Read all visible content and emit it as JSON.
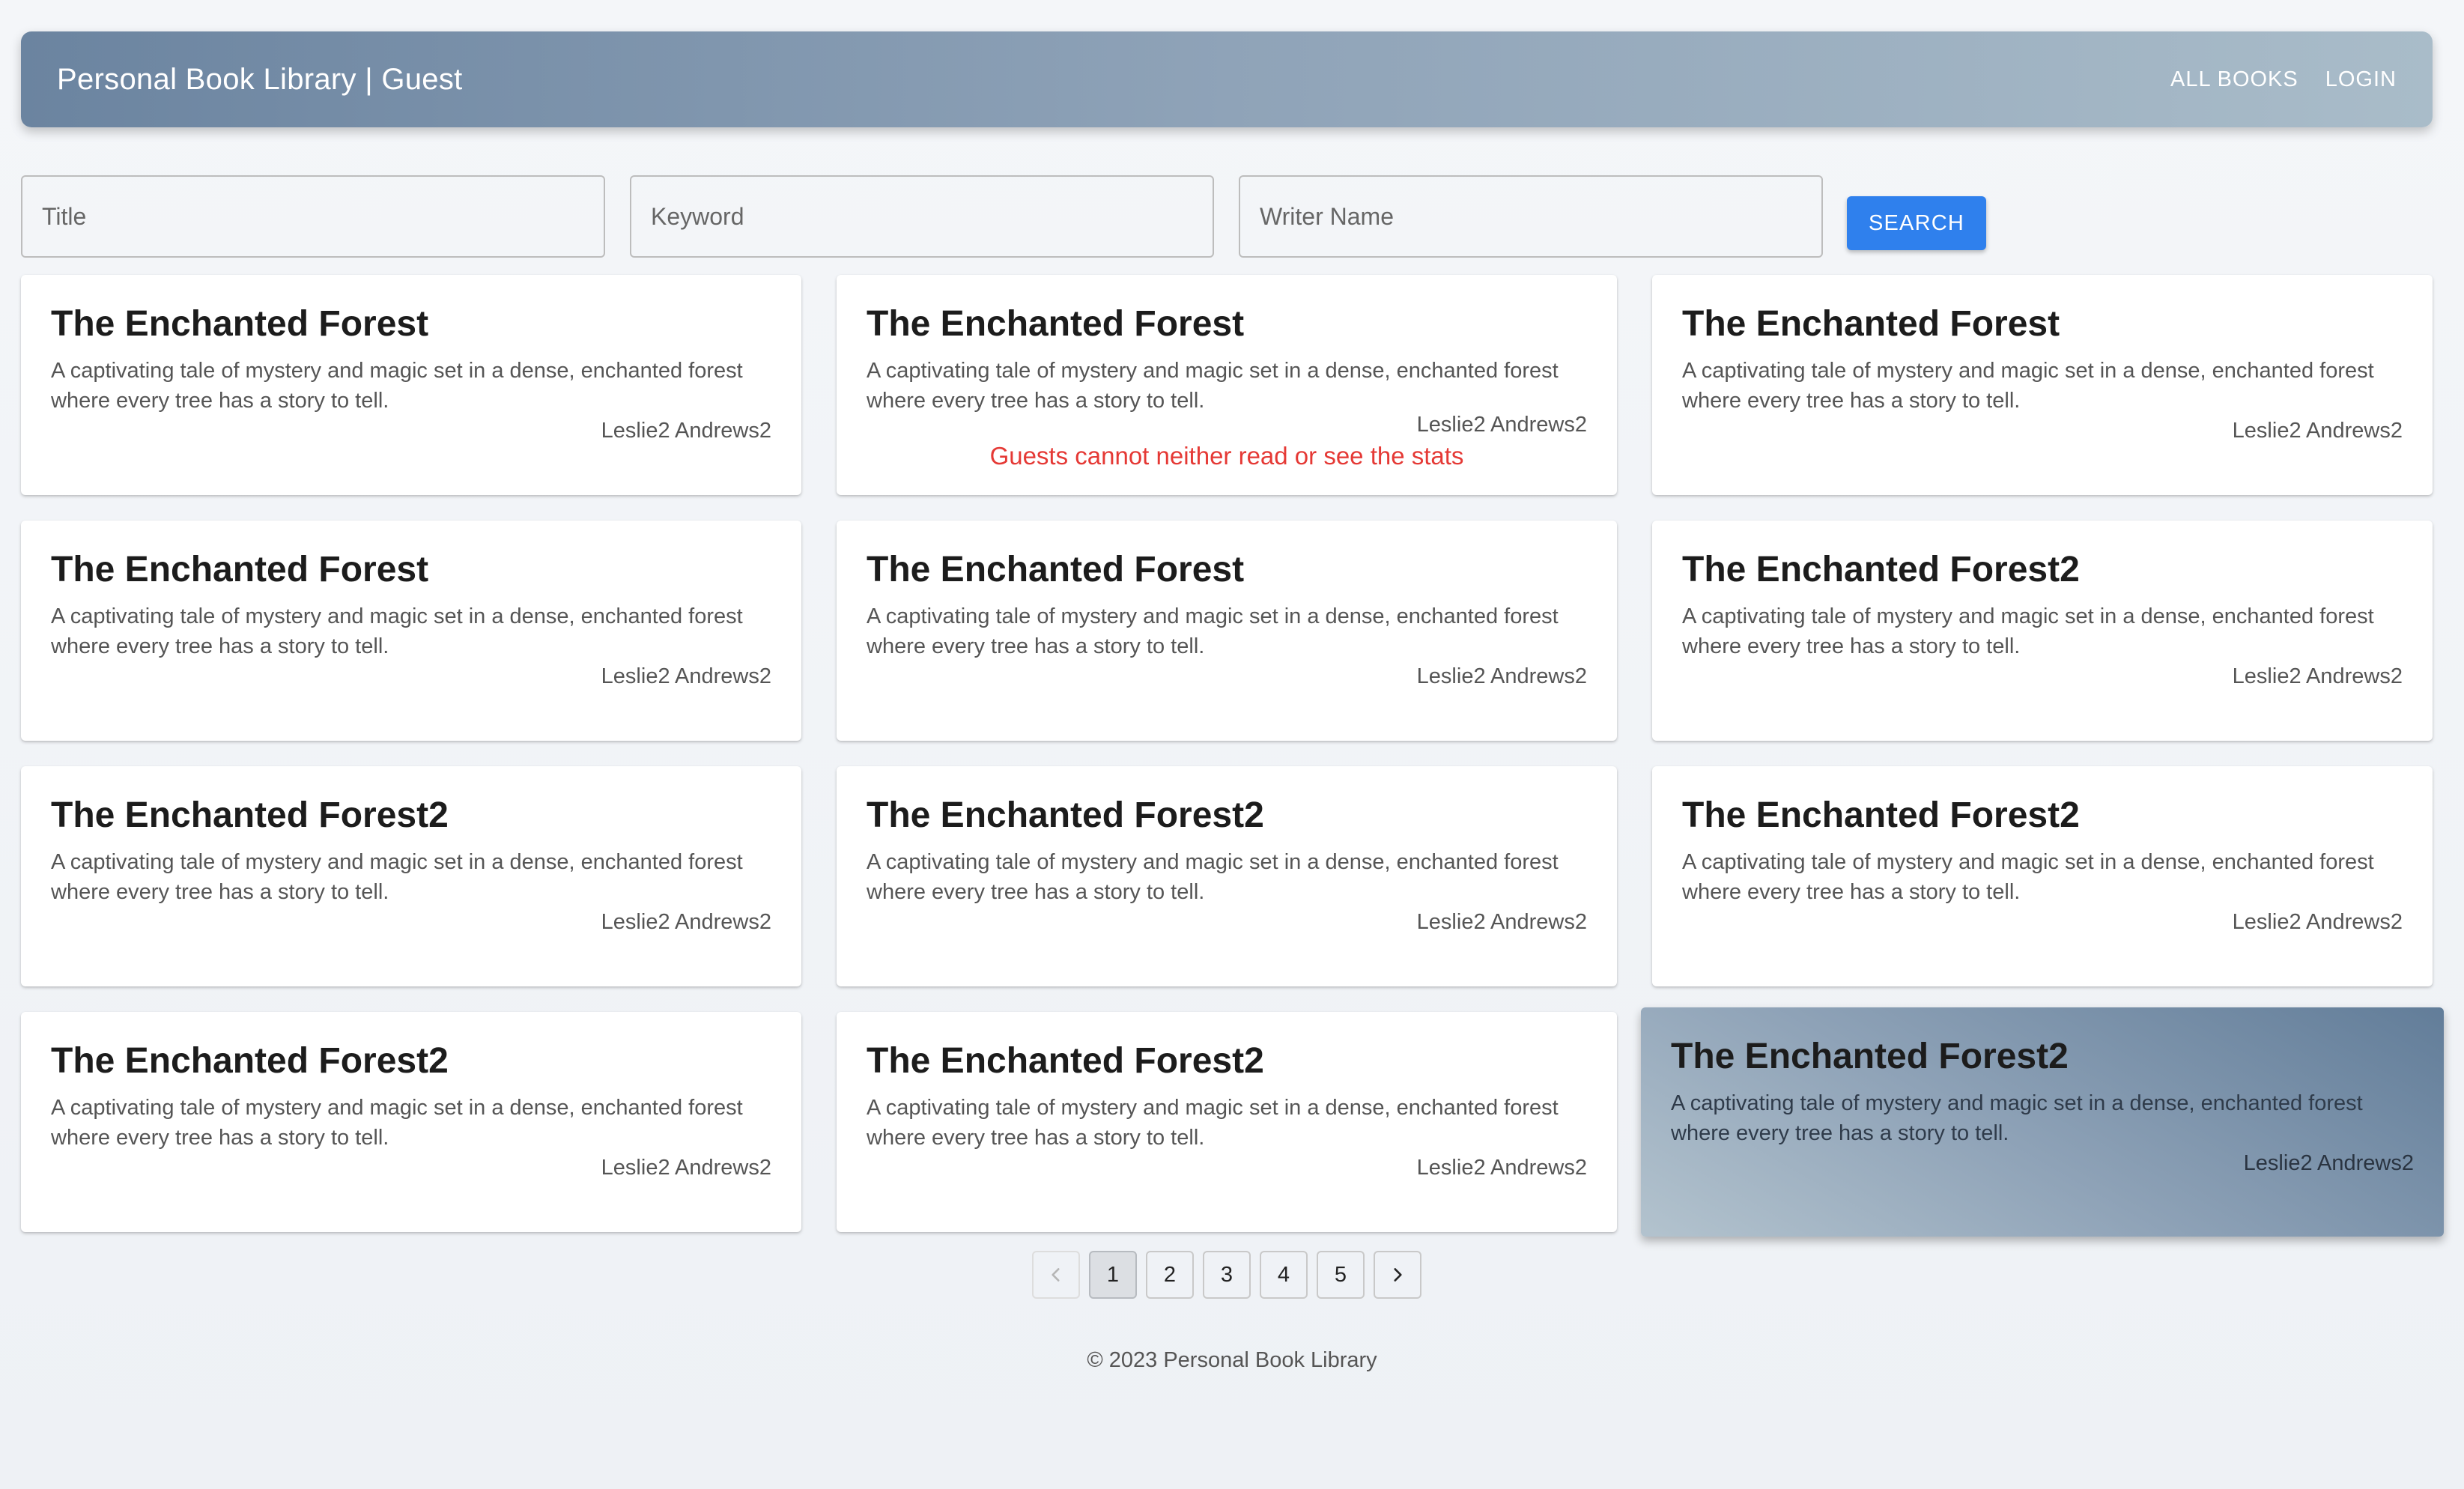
{
  "header": {
    "title": "Personal Book Library | Guest",
    "nav": [
      {
        "label": "ALL BOOKS"
      },
      {
        "label": "LOGIN"
      }
    ]
  },
  "search": {
    "title_placeholder": "Title",
    "keyword_placeholder": "Keyword",
    "writer_placeholder": "Writer Name",
    "button_label": "SEARCH"
  },
  "books": [
    {
      "title": "The Enchanted Forest",
      "description": "A captivating tale of mystery and magic set in a dense, enchanted forest where every tree has a story to tell.",
      "author": "Leslie2 Andrews2"
    },
    {
      "title": "The Enchanted Forest",
      "description": "A captivating tale of mystery and magic set in a dense, enchanted forest where every tree has a story to tell.",
      "author": "Leslie2 Andrews2",
      "notice": "Guests cannot neither read or see the stats"
    },
    {
      "title": "The Enchanted Forest",
      "description": "A captivating tale of mystery and magic set in a dense, enchanted forest where every tree has a story to tell.",
      "author": "Leslie2 Andrews2"
    },
    {
      "title": "The Enchanted Forest",
      "description": "A captivating tale of mystery and magic set in a dense, enchanted forest where every tree has a story to tell.",
      "author": "Leslie2 Andrews2"
    },
    {
      "title": "The Enchanted Forest",
      "description": "A captivating tale of mystery and magic set in a dense, enchanted forest where every tree has a story to tell.",
      "author": "Leslie2 Andrews2"
    },
    {
      "title": "The Enchanted Forest2",
      "description": "A captivating tale of mystery and magic set in a dense, enchanted forest where every tree has a story to tell.",
      "author": "Leslie2 Andrews2"
    },
    {
      "title": "The Enchanted Forest2",
      "description": "A captivating tale of mystery and magic set in a dense, enchanted forest where every tree has a story to tell.",
      "author": "Leslie2 Andrews2"
    },
    {
      "title": "The Enchanted Forest2",
      "description": "A captivating tale of mystery and magic set in a dense, enchanted forest where every tree has a story to tell.",
      "author": "Leslie2 Andrews2"
    },
    {
      "title": "The Enchanted Forest2",
      "description": "A captivating tale of mystery and magic set in a dense, enchanted forest where every tree has a story to tell.",
      "author": "Leslie2 Andrews2"
    },
    {
      "title": "The Enchanted Forest2",
      "description": "A captivating tale of mystery and magic set in a dense, enchanted forest where every tree has a story to tell.",
      "author": "Leslie2 Andrews2"
    },
    {
      "title": "The Enchanted Forest2",
      "description": "A captivating tale of mystery and magic set in a dense, enchanted forest where every tree has a story to tell.",
      "author": "Leslie2 Andrews2"
    },
    {
      "title": "The Enchanted Forest2",
      "description": "A captivating tale of mystery and magic set in a dense, enchanted forest where every tree has a story to tell.",
      "author": "Leslie2 Andrews2"
    }
  ],
  "pagination": {
    "pages": [
      "1",
      "2",
      "3",
      "4",
      "5"
    ],
    "current": "1",
    "prev_icon": "chevron-left-icon",
    "next_icon": "chevron-right-icon"
  },
  "footer": {
    "text": "© 2023 Personal Book Library"
  },
  "colors": {
    "accent": "#2f80ed",
    "notice": "#e53935",
    "header_gradient_start": "#6b84a0",
    "header_gradient_end": "#a9bcc9"
  }
}
